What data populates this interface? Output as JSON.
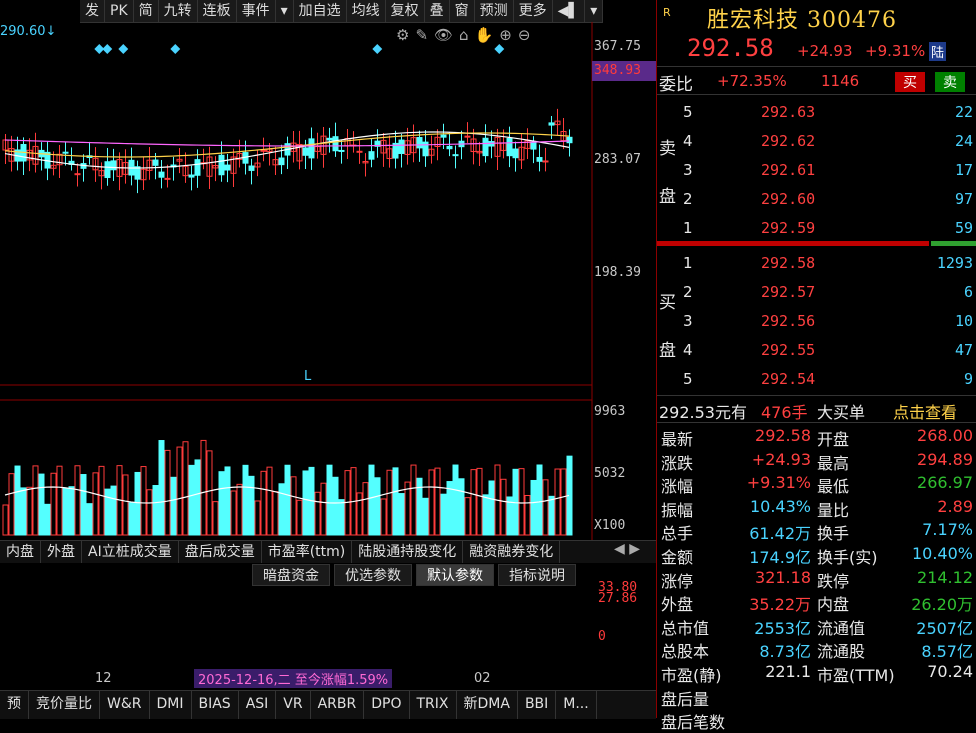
{
  "toolbar": [
    "发",
    "PK",
    "简",
    "九转",
    "连板",
    "事件",
    "▾",
    "加自选",
    "均线",
    "复权",
    "叠",
    "窗",
    "预测",
    "更多",
    "◀▌",
    "▾"
  ],
  "chart": {
    "price_tag": "290.60↓",
    "ticks": {
      "t1": "367.75",
      "t2": "348.93",
      "t3": "283.07",
      "t4": "198.39",
      "vol1": "9963",
      "vol2": "5032",
      "vol3": "X100",
      "ind1": "33.80",
      "ind2": "27.86",
      "ind3": "0"
    },
    "l_marker": "L",
    "date_left": "12",
    "date_right": "02",
    "range_label": "2025-12-16,二 至今涨幅1.59%"
  },
  "tabs1": [
    "内盘",
    "外盘",
    "AI立桩成交量",
    "盘后成交量",
    "市盈率(ttm)",
    "陆股通持股变化",
    "融资融券变化"
  ],
  "tabs2": [
    "暗盘资金",
    "优选参数",
    "默认参数",
    "指标说明"
  ],
  "tabs3": [
    "预",
    "竞价量比",
    "W&R",
    "DMI",
    "BIAS",
    "ASI",
    "VR",
    "ARBR",
    "DPO",
    "TRIX",
    "新DMA",
    "BBI",
    "M..."
  ],
  "stock": {
    "badge": "R",
    "name": "胜宏科技",
    "code": "300476",
    "price": "292.58",
    "change": "+24.93",
    "change_pct": "+9.31%",
    "tag": "陆",
    "weibi_label": "委比",
    "weibi_val": "+72.35%",
    "weicha": "1146",
    "buy_btn": "买",
    "sell_btn": "卖"
  },
  "asks": [
    {
      "lvl": "5",
      "price": "292.63",
      "vol": "22"
    },
    {
      "lvl": "4",
      "price": "292.62",
      "vol": "24"
    },
    {
      "lvl": "3",
      "price": "292.61",
      "vol": "17"
    },
    {
      "lvl": "2",
      "price": "292.60",
      "vol": "97"
    },
    {
      "lvl": "1",
      "price": "292.59",
      "vol": "59"
    }
  ],
  "bids": [
    {
      "lvl": "1",
      "price": "292.58",
      "vol": "1293"
    },
    {
      "lvl": "2",
      "price": "292.57",
      "vol": "6"
    },
    {
      "lvl": "3",
      "price": "292.56",
      "vol": "10"
    },
    {
      "lvl": "4",
      "price": "292.55",
      "vol": "47"
    },
    {
      "lvl": "5",
      "price": "292.54",
      "vol": "9"
    }
  ],
  "ask_label": [
    "卖",
    "盘"
  ],
  "bid_label": [
    "买",
    "盘"
  ],
  "bigorder": {
    "price": "292.53元有",
    "qty": "476手",
    "label": "大买单",
    "link": "点击查看"
  },
  "stats": [
    {
      "k1": "最新",
      "v1": "292.58",
      "c1": "red",
      "k2": "开盘",
      "v2": "268.00",
      "c2": "red"
    },
    {
      "k1": "涨跌",
      "v1": "+24.93",
      "c1": "red",
      "k2": "最高",
      "v2": "294.89",
      "c2": "red"
    },
    {
      "k1": "涨幅",
      "v1": "+9.31%",
      "c1": "red",
      "k2": "最低",
      "v2": "266.97",
      "c2": "green"
    },
    {
      "k1": "振幅",
      "v1": "10.43%",
      "c1": "cyan",
      "k2": "量比",
      "v2": "2.89",
      "c2": "red"
    },
    {
      "k1": "总手",
      "v1": "61.42万",
      "c1": "cyan",
      "k2": "换手",
      "v2": "7.17%",
      "c2": "cyan"
    },
    {
      "k1": "金额",
      "v1": "174.9亿",
      "c1": "cyan",
      "k2": "换手(实)",
      "v2": "10.40%",
      "c2": "cyan"
    },
    {
      "k1": "涨停",
      "v1": "321.18",
      "c1": "red",
      "k2": "跌停",
      "v2": "214.12",
      "c2": "green"
    },
    {
      "k1": "外盘",
      "v1": "35.22万",
      "c1": "red",
      "k2": "内盘",
      "v2": "26.20万",
      "c2": "green"
    },
    {
      "k1": "总市值",
      "v1": "2553亿",
      "c1": "cyan",
      "k2": "流通值",
      "v2": "2507亿",
      "c2": "cyan"
    },
    {
      "k1": "总股本",
      "v1": "8.73亿",
      "c1": "cyan",
      "k2": "流通股",
      "v2": "8.57亿",
      "c2": "cyan"
    },
    {
      "k1": "市盈(静)",
      "v1": "221.1",
      "c1": "white",
      "k2": "市盈(TTM)",
      "v2": "70.24",
      "c2": "white"
    },
    {
      "k1": "盘后量",
      "v1": "",
      "c1": "cyan",
      "k2": "",
      "v2": "",
      "c2": "cyan"
    },
    {
      "k1": "盘后笔数",
      "v1": "",
      "c1": "cyan",
      "k2": "",
      "v2": "",
      "c2": "cyan"
    }
  ]
}
